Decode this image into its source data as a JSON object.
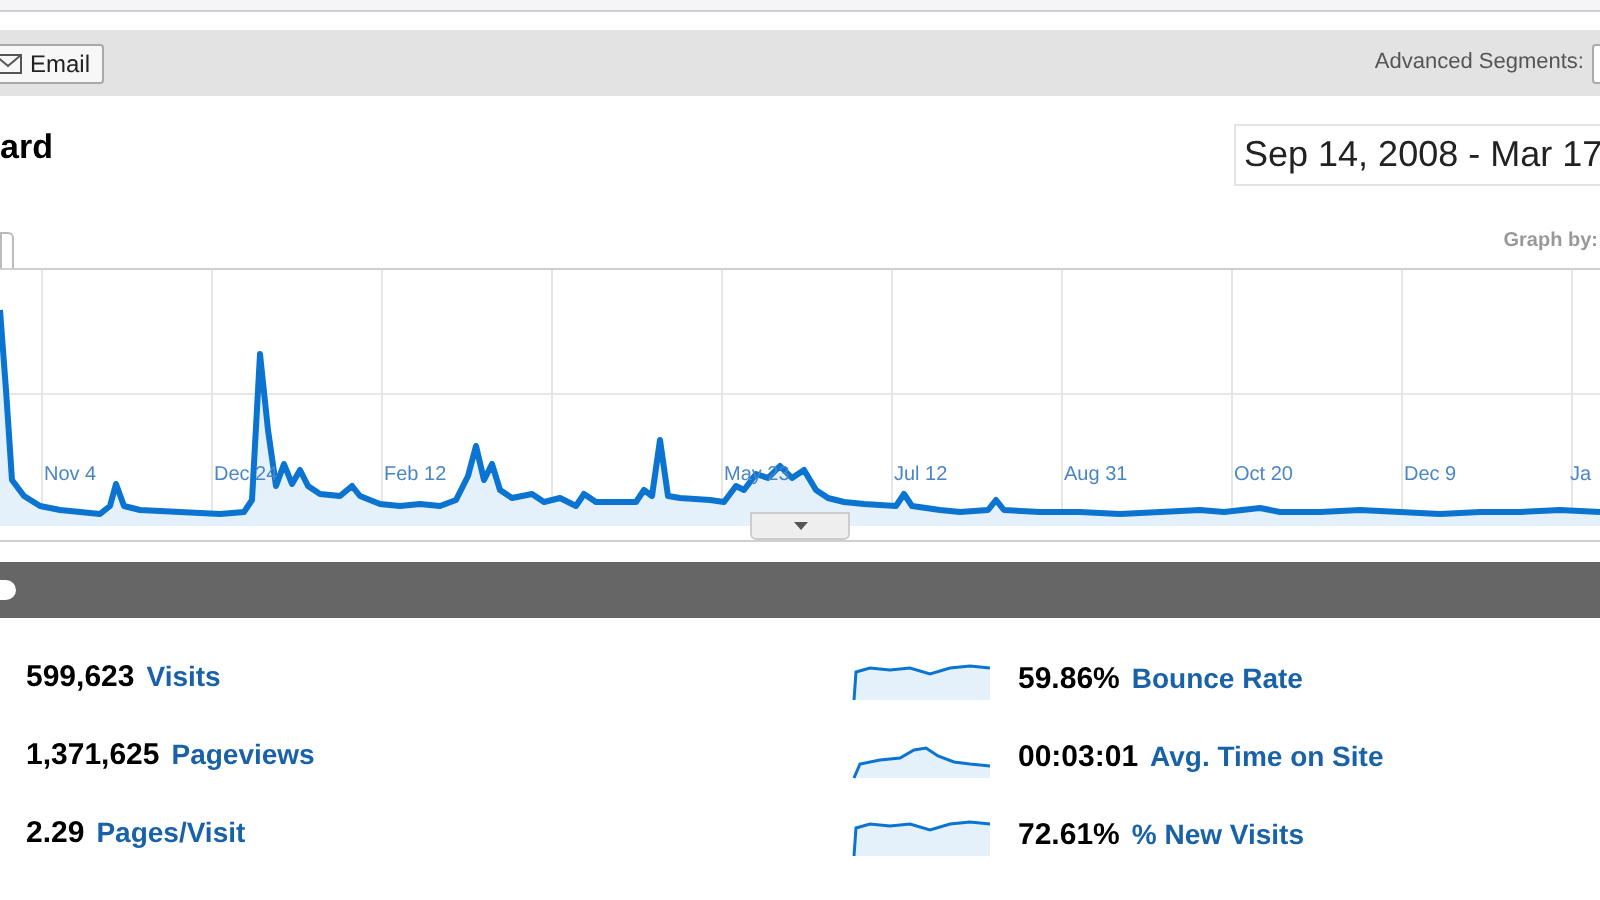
{
  "toolbar": {
    "email_button": "Email",
    "segments_label": "Advanced Segments:"
  },
  "page_title": "ard",
  "date_range": "Sep 14, 2008 - Mar 17",
  "graph_by_label": "Graph by:",
  "timeline": {
    "x_labels": [
      "Nov 4",
      "Dec 24",
      "Feb 12",
      "May 23",
      "Jul 12",
      "Aug 31",
      "Oct 20",
      "Dec 9",
      "Ja"
    ]
  },
  "metrics_left": [
    {
      "value": "599,623",
      "label": "Visits"
    },
    {
      "value": "1,371,625",
      "label": "Pageviews"
    },
    {
      "value": "2.29",
      "label": "Pages/Visit"
    }
  ],
  "metrics_right": [
    {
      "value": "59.86%",
      "label": "Bounce Rate",
      "kind": "flat"
    },
    {
      "value": "00:03:01",
      "label": "Avg. Time on Site",
      "kind": "hump"
    },
    {
      "value": "72.61%",
      "label": "% New Visits",
      "kind": "flat"
    }
  ]
}
